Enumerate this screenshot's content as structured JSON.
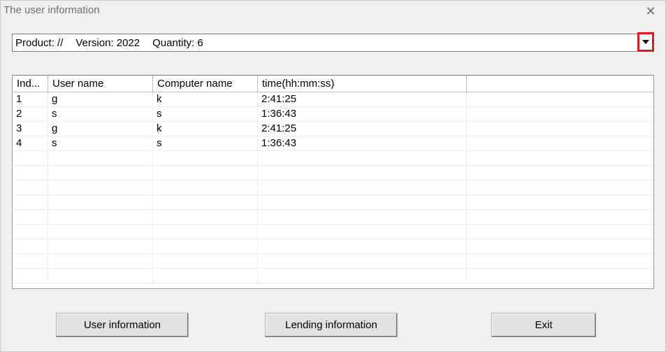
{
  "window": {
    "title": "The user information",
    "close_glyph": "✕"
  },
  "product_combo": {
    "product": "Product: //",
    "version": "Version: 2022",
    "quantity": "Quantity: 6",
    "highlight_color": "#e8161c"
  },
  "table": {
    "columns": [
      "Ind...",
      "User name",
      "Computer name",
      "time(hh:mm:ss)",
      ""
    ],
    "rows": [
      [
        "1",
        "g",
        "k",
        "2:41:25",
        ""
      ],
      [
        "2",
        "s",
        "s",
        "1:36:43",
        ""
      ],
      [
        "3",
        "g",
        "k",
        "2:41:25",
        ""
      ],
      [
        "4",
        "s",
        "s",
        "1:36:43",
        ""
      ]
    ],
    "empty_rows": 9
  },
  "buttons": {
    "user_info": "User information",
    "lending_info": "Lending information",
    "exit": "Exit"
  }
}
